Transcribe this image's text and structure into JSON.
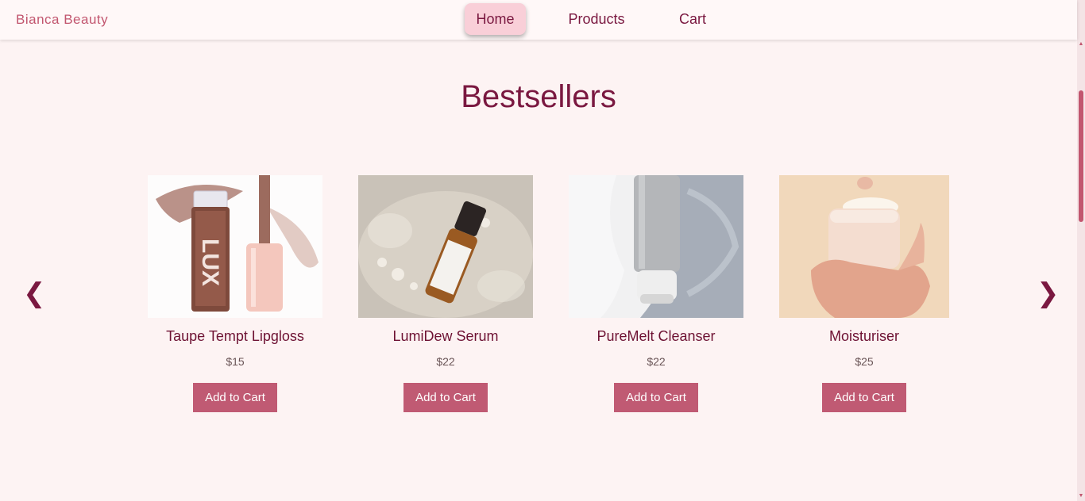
{
  "brand": "Bianca Beauty",
  "nav": {
    "home": "Home",
    "products": "Products",
    "cart": "Cart"
  },
  "section_title": "Bestsellers",
  "carousel": {
    "prev": "❮",
    "next": "❯"
  },
  "products": [
    {
      "name": "Taupe Tempt Lipgloss",
      "price": "$15",
      "button": "Add to Cart",
      "image": "lipgloss-product-photo"
    },
    {
      "name": "LumiDew Serum",
      "price": "$22",
      "button": "Add to Cart",
      "image": "serum-bottle-photo"
    },
    {
      "name": "PureMelt Cleanser",
      "price": "$22",
      "button": "Add to Cart",
      "image": "cleanser-tube-photo"
    },
    {
      "name": "Moisturiser",
      "price": "$25",
      "button": "Add to Cart",
      "image": "moisturiser-jar-photo"
    }
  ],
  "colors": {
    "accent": "#c05a73",
    "heading": "#7a1840",
    "background": "#fdf3f3",
    "nav_active": "#f9cfd8"
  }
}
